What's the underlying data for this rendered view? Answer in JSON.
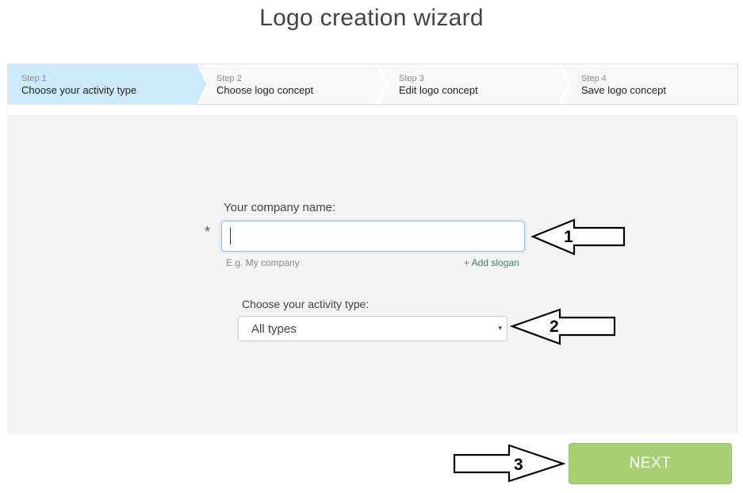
{
  "page": {
    "title": "Logo creation wizard"
  },
  "steps": [
    {
      "num": "Step 1",
      "label": "Choose your activity type",
      "active": true
    },
    {
      "num": "Step 2",
      "label": "Choose logo concept",
      "active": false
    },
    {
      "num": "Step 3",
      "label": "Edit logo concept",
      "active": false
    },
    {
      "num": "Step 4",
      "label": "Save logo concept",
      "active": false
    }
  ],
  "form": {
    "company_label": "Your company name:",
    "required_mark": "*",
    "company_value": "",
    "company_hint": "E.g. My company",
    "add_slogan": "+ Add slogan",
    "activity_label": "Choose your activity type:",
    "activity_selected": "All types",
    "select_arrow": "▾"
  },
  "buttons": {
    "next": "NEXT"
  },
  "annotations": {
    "arrow1": "1",
    "arrow2": "2",
    "arrow3": "3"
  },
  "colors": {
    "active_step": "#cdeafa",
    "panel_bg": "#f4f4f4",
    "next_bg": "#a6d072",
    "input_focus": "#8cc5ea",
    "slogan_link": "#3f7f6e"
  }
}
